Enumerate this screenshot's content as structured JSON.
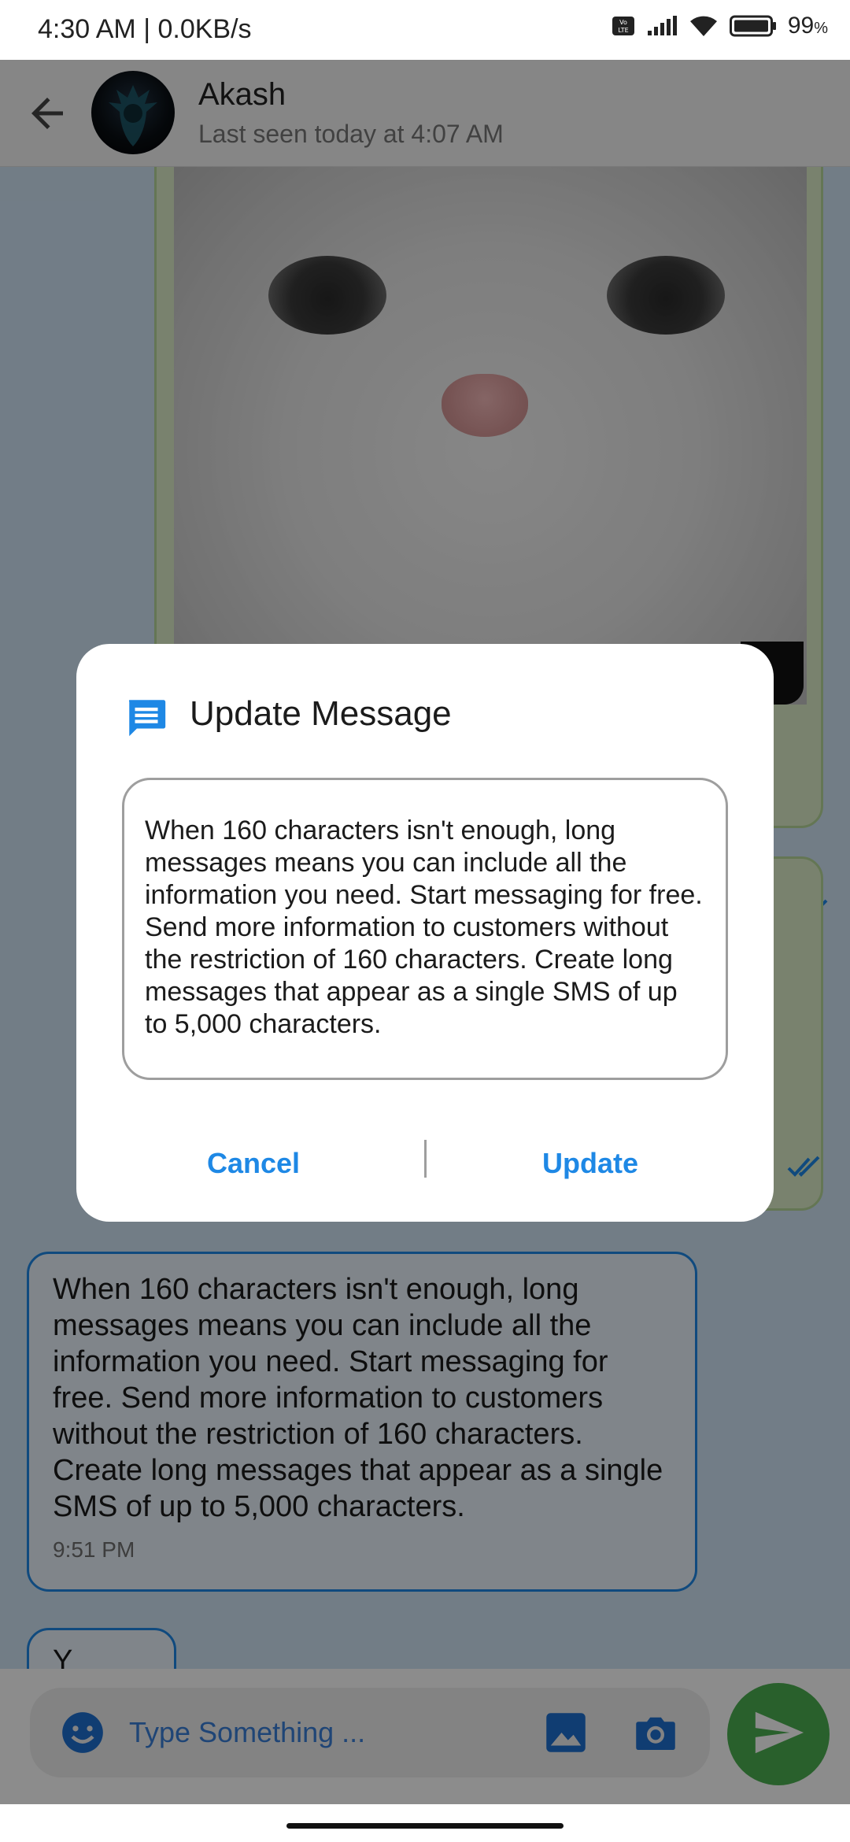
{
  "status_bar": {
    "time_speed": "4:30 AM | 0.0KB/s",
    "battery_percent": "99",
    "battery_unit": "%",
    "icons": [
      "volte-icon",
      "signal-icon",
      "wifi-icon",
      "battery-icon"
    ]
  },
  "header": {
    "contact_name": "Akash",
    "last_seen": "Last seen today at 4:07 AM"
  },
  "chat": {
    "messages": [
      {
        "text": "When 160 characters isn't enough, long messages means you can include all the information you need. Start messaging for free. Send more information to customers without the restriction of 160 characters. Create long messages that appear as a single SMS of up to 5,000 characters.",
        "time": "9:51 PM"
      },
      {
        "text": "Y"
      }
    ]
  },
  "input": {
    "placeholder": "Type Something ..."
  },
  "dialog": {
    "title": "Update Message",
    "message_text": "When 160 characters isn't enough, long messages means you can include all the information you need. Start messaging for free. Send more information to customers without the restriction of 160 characters. Create long messages that appear as a single SMS of up to 5,000 characters.",
    "cancel_label": "Cancel",
    "update_label": "Update"
  },
  "colors": {
    "accent": "#1e88e5",
    "send_button": "#4caf50",
    "sent_bubble": "#dcedc8",
    "received_bubble_border": "#1e88e5"
  }
}
